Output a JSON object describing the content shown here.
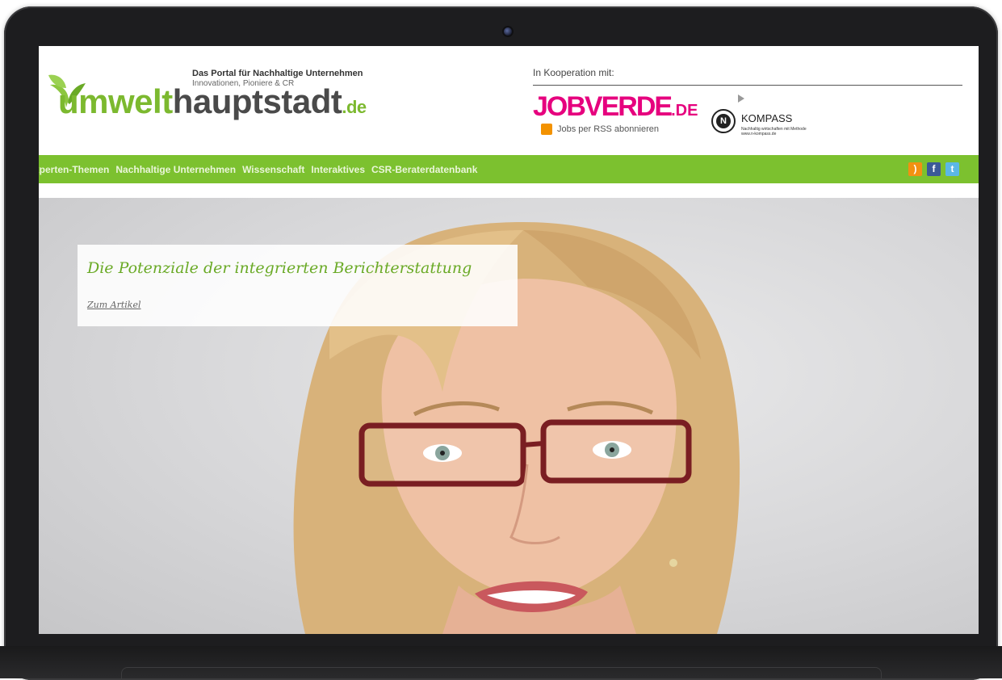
{
  "header": {
    "logo_umwelt": "umwelt",
    "logo_haupt": "hauptstadt",
    "logo_de": ".de",
    "tagline_bold": "Das Portal für Nachhaltige Unternehmen",
    "tagline_sub": "Innovationen, Pioniere & CR",
    "cooperation_label": "In Kooperation mit:",
    "jobverde_main": "JOBVERDE",
    "jobverde_suffix": ".DE",
    "rss_link": "Jobs per RSS abonnieren",
    "kompass_letter": "N",
    "kompass_name": "KOMPASS",
    "kompass_sub1": "Nachhaltig wirtschaften mit Methode",
    "kompass_sub2": "www.n-kompass.de"
  },
  "nav": {
    "items": [
      {
        "label": "xperten-Themen"
      },
      {
        "label": "Nachhaltige Unternehmen"
      },
      {
        "label": "Wissenschaft"
      },
      {
        "label": "Interaktives"
      },
      {
        "label": "CSR-Beraterdatenbank"
      }
    ],
    "social": [
      {
        "name": "rss-icon",
        "glyph": ")"
      },
      {
        "name": "facebook-icon",
        "glyph": "f"
      },
      {
        "name": "twitter-icon",
        "glyph": "t"
      }
    ]
  },
  "hero": {
    "title": "Die Potenziale der integrierten Berichterstattung",
    "link": "Zum Artikel"
  },
  "colors": {
    "brand_green": "#7cc12f",
    "logo_gray": "#4a4a4a",
    "jobverde_pink": "#e6007e",
    "frame": "#1d1d1f"
  }
}
